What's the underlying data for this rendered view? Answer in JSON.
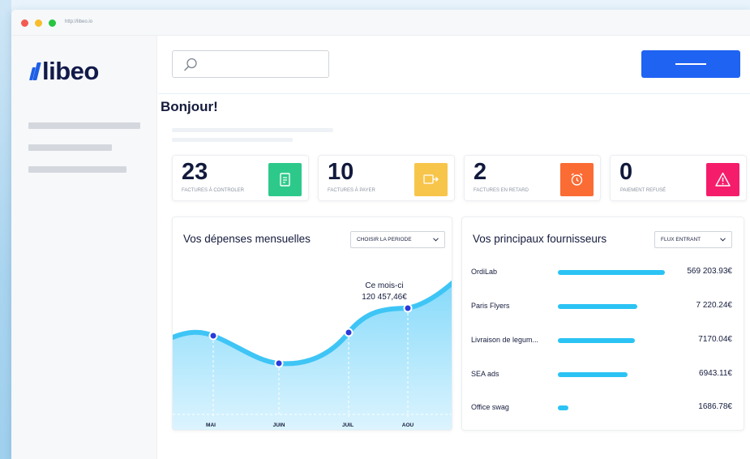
{
  "browser": {
    "url": "http://libeo.io"
  },
  "brand": {
    "name": "libeo",
    "color": "#1e5fe6"
  },
  "search": {
    "placeholder": "",
    "icon": "search-icon"
  },
  "header": {
    "greeting": "Bonjour!"
  },
  "kpis": [
    {
      "value": "23",
      "label": "FACTURES À CONTROLER",
      "icon": "document-icon",
      "color": "#2dc98a"
    },
    {
      "value": "10",
      "label": "FACTURES À PAYER",
      "icon": "wallet-transfer-icon",
      "color": "#f7c54a"
    },
    {
      "value": "2",
      "label": "FACTURES EN RETARD",
      "icon": "alarm-clock-icon",
      "color": "#fb6b34"
    },
    {
      "value": "0",
      "label": "PAIEMENT REFUSÉ",
      "icon": "warning-icon",
      "color": "#f51d6b"
    }
  ],
  "spending": {
    "title": "Vos dépenses mensuelles",
    "period_select": "CHOISIR LA PERIODE",
    "annotation_line1": "Ce mois-ci",
    "annotation_line2": "120 457,46€"
  },
  "chart_data": {
    "type": "area",
    "categories": [
      "MAI",
      "JUIN",
      "JUIL",
      "AOU"
    ],
    "y_axis_printed": false,
    "grid": false
  },
  "suppliers": {
    "title": "Vos principaux fournisseurs",
    "flux_select": "FLUX ENTRANT",
    "items": [
      {
        "name": "OrdiLab",
        "amount": "569 203.93€",
        "share": 1.0
      },
      {
        "name": "Paris Flyers",
        "amount": "7 220.24€",
        "share": 0.74
      },
      {
        "name": "Livraison de legum...",
        "amount": "7170.04€",
        "share": 0.72
      },
      {
        "name": "SEA ads",
        "amount": "6943.11€",
        "share": 0.65
      },
      {
        "name": "Office swag",
        "amount": "1686.78€",
        "share": 0.1
      }
    ]
  },
  "colors": {
    "primary_button": "#1f63f2",
    "chart_line": "#3ec5f5",
    "chart_point": "#2a3adb"
  }
}
